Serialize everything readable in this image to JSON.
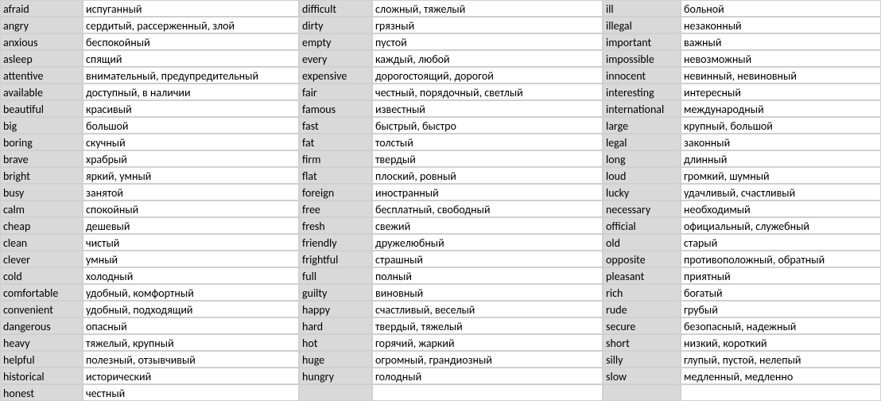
{
  "rows": [
    {
      "c1e": "afraid",
      "c1r": "испуганный",
      "c2e": "difficult",
      "c2r": "сложный, тяжелый",
      "c3e": "ill",
      "c3r": "больной"
    },
    {
      "c1e": "angry",
      "c1r": "сердитый, рассерженный, злой",
      "c2e": "dirty",
      "c2r": "грязный",
      "c3e": "illegal",
      "c3r": "незаконный"
    },
    {
      "c1e": "anxious",
      "c1r": "беспокойный",
      "c2e": "empty",
      "c2r": "пустой",
      "c3e": "important",
      "c3r": "важный"
    },
    {
      "c1e": "asleep",
      "c1r": "спящий",
      "c2e": "every",
      "c2r": "каждый, любой",
      "c3e": "impossible",
      "c3r": "невозможный"
    },
    {
      "c1e": "attentive",
      "c1r": "внимательный, предупредительный",
      "c2e": "expensive",
      "c2r": "дорогостоящий, дорогой",
      "c3e": "innocent",
      "c3r": "невинный, невиновный"
    },
    {
      "c1e": "available",
      "c1r": "доступный, в наличии",
      "c2e": "fair",
      "c2r": "честный, порядочный, светлый",
      "c3e": "interesting",
      "c3r": "интересный"
    },
    {
      "c1e": "beautiful",
      "c1r": "красивый",
      "c2e": "famous",
      "c2r": "известный",
      "c3e": "international",
      "c3r": "международный"
    },
    {
      "c1e": "big",
      "c1r": "большой",
      "c2e": "fast",
      "c2r": "быстрый, быстро",
      "c3e": "large",
      "c3r": "крупный, большой"
    },
    {
      "c1e": "boring",
      "c1r": "скучный",
      "c2e": "fat",
      "c2r": "толстый",
      "c3e": "legal",
      "c3r": "законный"
    },
    {
      "c1e": "brave",
      "c1r": "храбрый",
      "c2e": "firm",
      "c2r": "твердый",
      "c3e": "long",
      "c3r": "длинный"
    },
    {
      "c1e": "bright",
      "c1r": "яркий, умный",
      "c2e": "flat",
      "c2r": "плоский, ровный",
      "c3e": "loud",
      "c3r": "громкий, шумный"
    },
    {
      "c1e": "busy",
      "c1r": "занятой",
      "c2e": "foreign",
      "c2r": "иностранный",
      "c3e": "lucky",
      "c3r": "удачливый, счастливый"
    },
    {
      "c1e": "calm",
      "c1r": "спокойный",
      "c2e": "free",
      "c2r": "бесплатный, свободный",
      "c3e": "necessary",
      "c3r": "необходимый"
    },
    {
      "c1e": "cheap",
      "c1r": "дешевый",
      "c2e": "fresh",
      "c2r": "свежий",
      "c3e": "official",
      "c3r": "официальный, служебный"
    },
    {
      "c1e": "clean",
      "c1r": "чистый",
      "c2e": "friendly",
      "c2r": "дружелюбный",
      "c3e": "old",
      "c3r": "старый"
    },
    {
      "c1e": "clever",
      "c1r": "умный",
      "c2e": "frightful",
      "c2r": "страшный",
      "c3e": "opposite",
      "c3r": "противоположный, обратный"
    },
    {
      "c1e": "cold",
      "c1r": "холодный",
      "c2e": "full",
      "c2r": "полный",
      "c3e": "pleasant",
      "c3r": "приятный"
    },
    {
      "c1e": "comfortable",
      "c1r": "удобный, комфортный",
      "c2e": "guilty",
      "c2r": "виновный",
      "c3e": "rich",
      "c3r": "богатый"
    },
    {
      "c1e": "convenient",
      "c1r": "удобный, подходящий",
      "c2e": "happy",
      "c2r": "счастливый, веселый",
      "c3e": "rude",
      "c3r": "грубый"
    },
    {
      "c1e": "dangerous",
      "c1r": "опасный",
      "c2e": "hard",
      "c2r": "твердый, тяжелый",
      "c3e": "secure",
      "c3r": "безопасный, надежный"
    },
    {
      "c1e": "heavy",
      "c1r": "тяжелый, крупный",
      "c2e": "hot",
      "c2r": "горячий, жаркий",
      "c3e": "short",
      "c3r": "низкий, короткий"
    },
    {
      "c1e": "helpful",
      "c1r": "полезный, отзывчивый",
      "c2e": "huge",
      "c2r": "огромный, грандиозный",
      "c3e": "silly",
      "c3r": "глупый, пустой, нелепый"
    },
    {
      "c1e": "historical",
      "c1r": "исторический",
      "c2e": "hungry",
      "c2r": "голодный",
      "c3e": "slow",
      "c3r": "медленный, медленно"
    },
    {
      "c1e": "honest",
      "c1r": "честный",
      "c2e": "",
      "c2r": "",
      "c3e": "",
      "c3r": ""
    }
  ]
}
